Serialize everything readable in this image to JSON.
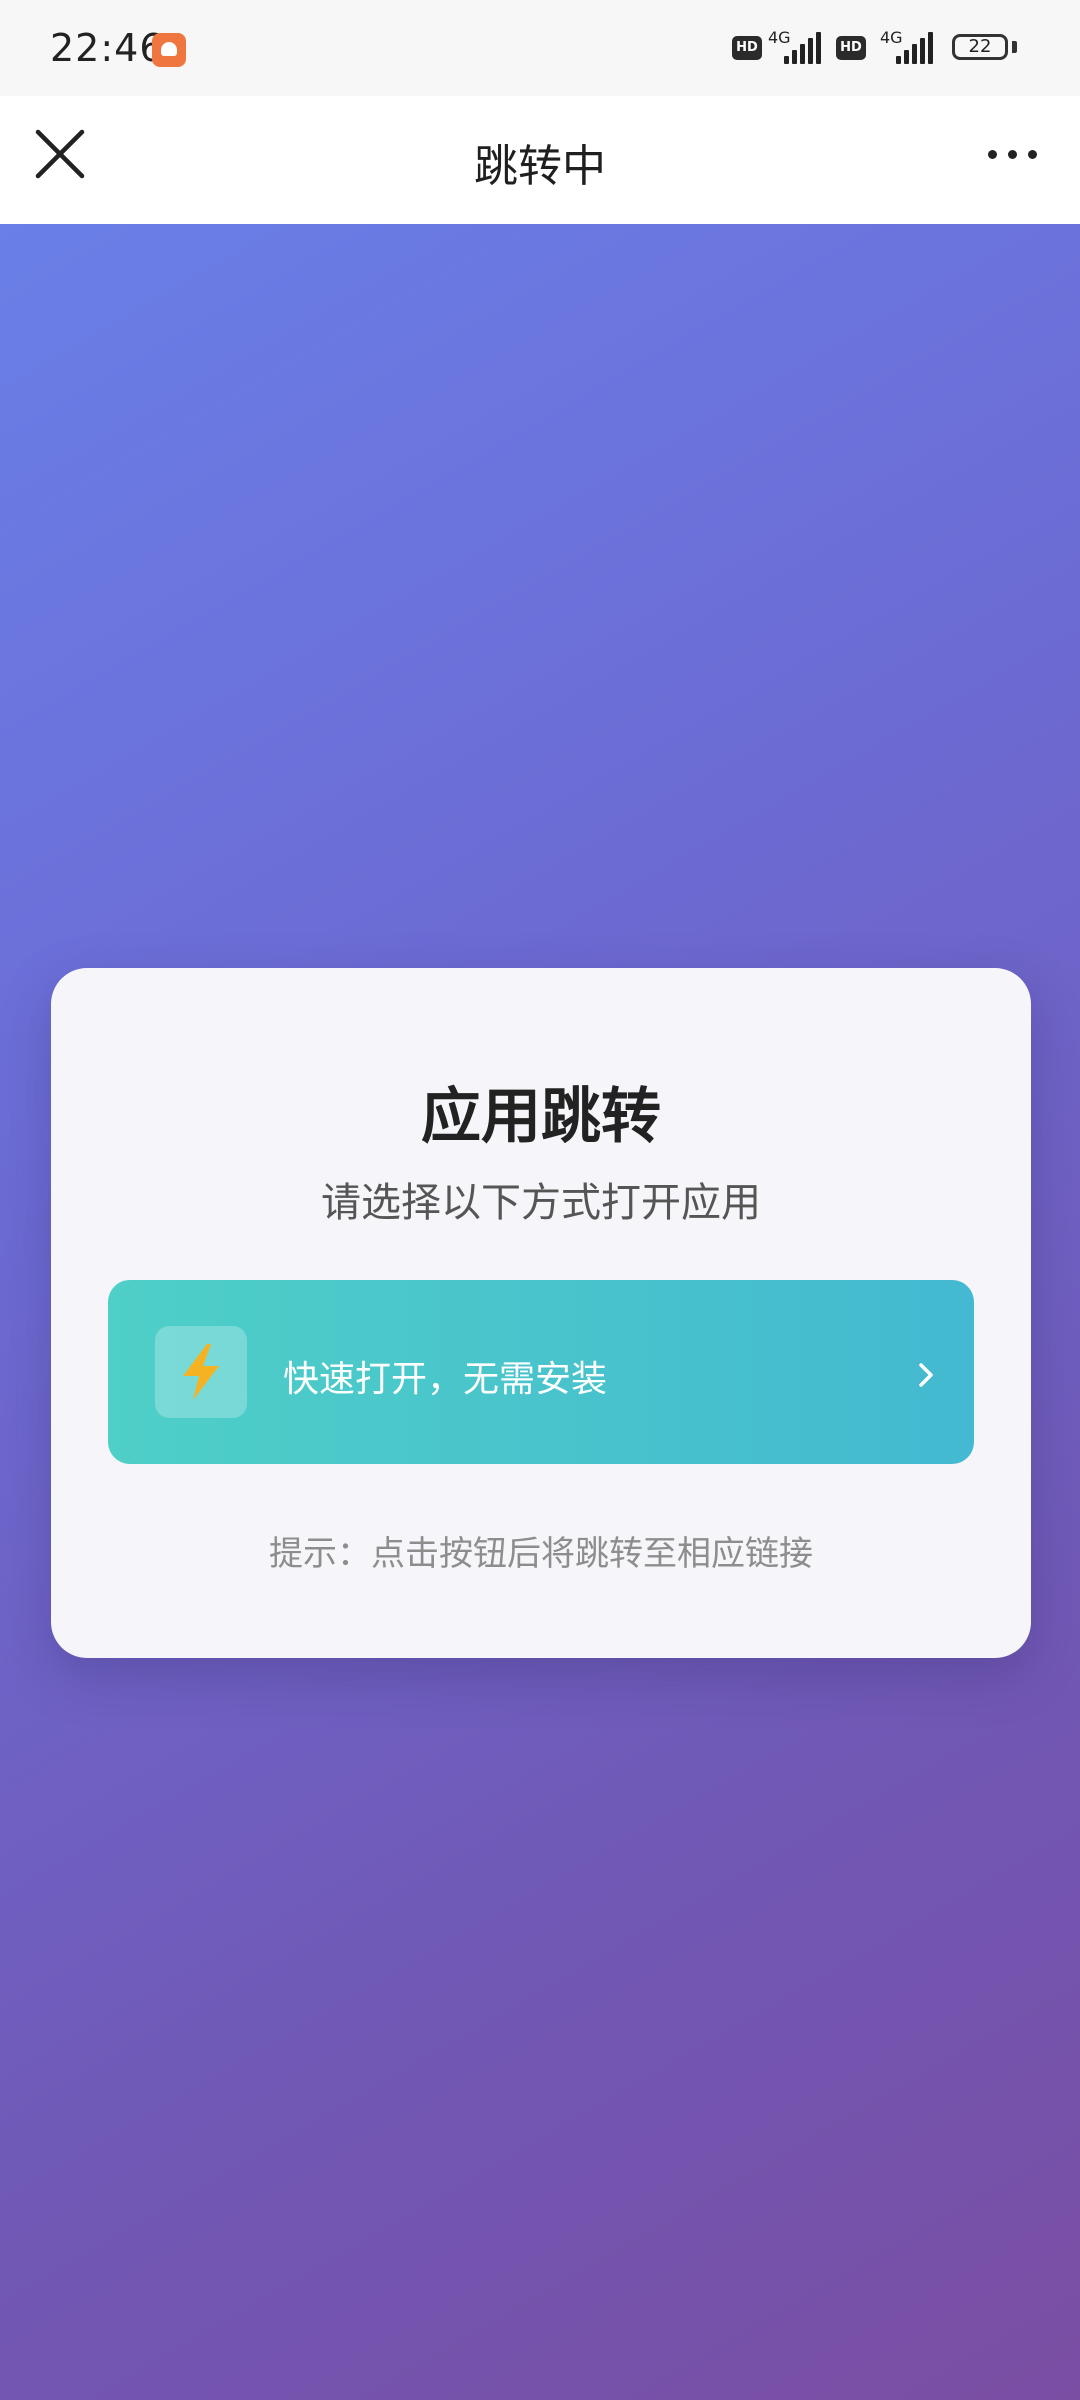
{
  "status_bar": {
    "time": "22:46",
    "battery": "22",
    "sim1": {
      "hd": "HD",
      "network": "4G"
    },
    "sim2": {
      "hd": "HD",
      "network": "4G"
    }
  },
  "nav": {
    "title": "跳转中",
    "close_icon": "close-icon",
    "more_icon": "more-horizontal-icon"
  },
  "card": {
    "title": "应用跳转",
    "subtitle": "请选择以下方式打开应用",
    "button": {
      "icon": "lightning-icon",
      "label": "快速打开，无需安装",
      "chevron": "chevron-right-icon"
    },
    "hint": "提示：点击按钮后将跳转至相应链接"
  },
  "colors": {
    "bg_gradient_start": "#6a7fe8",
    "bg_gradient_end": "#7a4ea3",
    "button_start": "#4ecfc7",
    "button_end": "#44b9d1",
    "bolt": "#f5b324"
  }
}
